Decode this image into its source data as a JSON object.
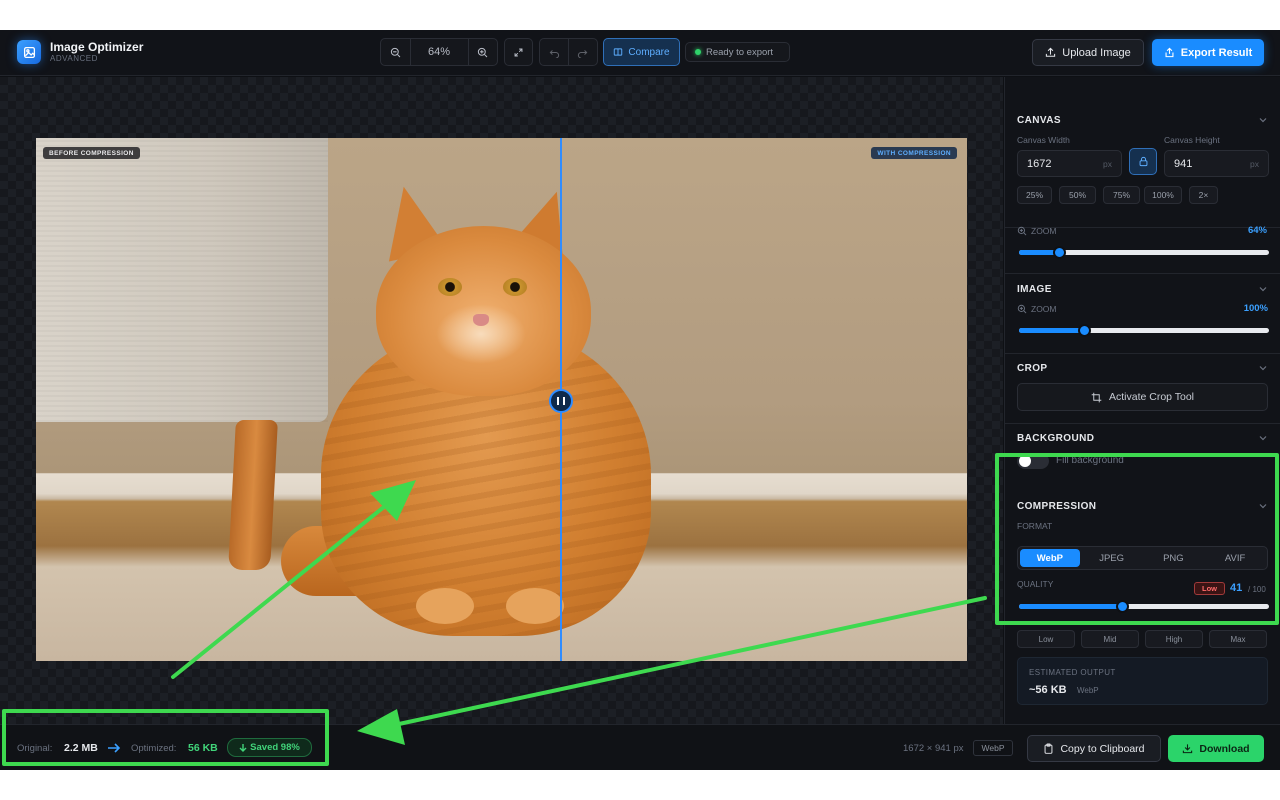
{
  "app": {
    "title": "Image Optimizer",
    "subtitle": "ADVANCED"
  },
  "toolbar": {
    "zoom_level": "64%",
    "compare_label": "Compare",
    "status_text": "Ready to export",
    "upload_label": "Upload Image",
    "export_label": "Export Result"
  },
  "preview": {
    "before_tag": "BEFORE COMPRESSION",
    "after_tag": "WITH COMPRESSION"
  },
  "bottom": {
    "original_label": "Original:",
    "original_value": "2.2 MB",
    "optimized_label": "Optimized:",
    "optimized_value": "56 KB",
    "saved_label": "Saved 98%",
    "dimensions": "1672 × 941 px",
    "format": "WebP",
    "copy_label": "Copy to Clipboard",
    "download_label": "Download"
  },
  "canvas": {
    "title": "CANVAS",
    "width_label": "Canvas Width",
    "width_value": "1672",
    "height_label": "Canvas Height",
    "height_value": "941",
    "unit": "px",
    "presets": [
      "25%",
      "50%",
      "75%",
      "100%",
      "2×"
    ],
    "zoom_label": "ZOOM",
    "zoom_value": "64%",
    "zoom_fraction": 0.16
  },
  "image": {
    "title": "IMAGE",
    "zoom_label": "ZOOM",
    "zoom_value": "100%",
    "zoom_fraction": 0.26
  },
  "crop": {
    "title": "CROP",
    "button_label": "Activate Crop Tool"
  },
  "background": {
    "title": "BACKGROUND",
    "toggle_label": "Fill background",
    "enabled": false
  },
  "compression": {
    "title": "COMPRESSION",
    "format_label": "FORMAT",
    "formats": [
      "WebP",
      "JPEG",
      "PNG",
      "AVIF"
    ],
    "selected_format": "WebP",
    "quality_label": "QUALITY",
    "quality_badge": "Low",
    "quality_value": "41",
    "quality_max": "/ 100",
    "quality_fraction": 0.41,
    "presets": [
      "Low",
      "Mid",
      "High",
      "Max"
    ]
  },
  "estimate": {
    "title": "ESTIMATED OUTPUT",
    "value": "~56 KB",
    "format": "WebP"
  },
  "colors": {
    "accent": "#1a8cff",
    "success": "#2bd46a",
    "annotation": "#3ed94f",
    "warning": "#ff6b6b"
  }
}
